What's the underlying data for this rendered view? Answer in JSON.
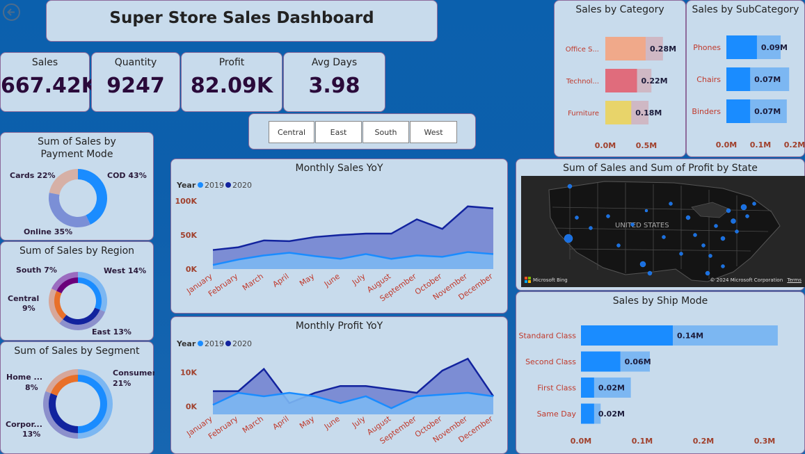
{
  "header": {
    "title": "Super Store Sales Dashboard"
  },
  "kpis": [
    {
      "label": "Sales",
      "value": "667.42K"
    },
    {
      "label": "Quantity",
      "value": "9247"
    },
    {
      "label": "Profit",
      "value": "82.09K"
    },
    {
      "label": "Avg Days",
      "value": "3.98"
    }
  ],
  "slicer": {
    "options": [
      "Central",
      "East",
      "South",
      "West"
    ]
  },
  "colors": {
    "accent": "#1a8cff",
    "dark": "#12239e",
    "light": "#7cb7f2"
  },
  "chart_data": [
    {
      "id": "category",
      "type": "bar",
      "title": "Sales by Category",
      "categories": [
        "Office S...",
        "Technol...",
        "Furniture"
      ],
      "values": [
        0.28,
        0.22,
        0.18
      ],
      "data_labels": [
        "0.28M",
        "0.22M",
        "0.18M"
      ],
      "ticks": [
        "0.0M",
        "0.5M"
      ],
      "colors": [
        "#f0a98a",
        "#e06c7c",
        "#e8d46a"
      ],
      "xlim": [
        0,
        0.57
      ]
    },
    {
      "id": "subcategory",
      "type": "bar",
      "title": "Sales by SubCategory",
      "categories": [
        "Phones",
        "Chairs",
        "Binders"
      ],
      "values": [
        0.09,
        0.07,
        0.07
      ],
      "data_labels": [
        "0.09M",
        "0.07M",
        "0.07M"
      ],
      "ticks": [
        "0.0M",
        "0.1M",
        "0.2M"
      ],
      "xlim": [
        0,
        0.205
      ]
    },
    {
      "id": "payment",
      "type": "pie",
      "title": "Sum of Sales by Payment Mode",
      "labels": [
        "COD 43%",
        "Online 35%",
        "Cards 22%"
      ],
      "values": [
        43,
        35,
        22
      ],
      "colors": [
        "#1a8cff",
        "#7b8fd6",
        "#d6b0a6"
      ]
    },
    {
      "id": "region",
      "type": "pie",
      "title": "Sum of Sales by Region",
      "labels": [
        "West 14%",
        "East 13%",
        "Central 9%",
        "South 7%"
      ],
      "outer": {
        "values": [
          31,
          30,
          21,
          18
        ],
        "colors": [
          "#7cb7f2",
          "#8c90cc",
          "#d7a79a",
          "#9b6cc0"
        ]
      },
      "inner": {
        "values": [
          31,
          30,
          21,
          18
        ],
        "colors": [
          "#1a8cff",
          "#12239e",
          "#e8702a",
          "#6b007b"
        ]
      }
    },
    {
      "id": "segment",
      "type": "pie",
      "title": "Sum of Sales by Segment",
      "labels": [
        "Consumer 21%",
        "Corpor... 13%",
        "Home ... 8%"
      ],
      "outer": {
        "values": [
          50,
          31,
          19
        ],
        "colors": [
          "#7cb7f2",
          "#8c90cc",
          "#d7a79a"
        ]
      },
      "inner": {
        "values": [
          50,
          31,
          19
        ],
        "colors": [
          "#1a8cff",
          "#12239e",
          "#e8702a"
        ]
      }
    },
    {
      "id": "monthly_sales",
      "type": "area",
      "title": "Monthly Sales YoY",
      "legend_title": "Year",
      "x": [
        "January",
        "February",
        "March",
        "April",
        "May",
        "June",
        "July",
        "August",
        "September",
        "October",
        "November",
        "December"
      ],
      "series": [
        {
          "name": "2019",
          "values": [
            6,
            14,
            20,
            24,
            19,
            15,
            22,
            15,
            20,
            18,
            25,
            22
          ]
        },
        {
          "name": "2020",
          "values": [
            28,
            32,
            42,
            41,
            47,
            50,
            52,
            52,
            73,
            59,
            92,
            89
          ]
        }
      ],
      "yticks": [
        "0K",
        "50K",
        "100K"
      ],
      "ylim": [
        0,
        100
      ]
    },
    {
      "id": "monthly_profit",
      "type": "area",
      "title": "Monthly Profit YoY",
      "legend_title": "Year",
      "x": [
        "January",
        "February",
        "March",
        "April",
        "May",
        "June",
        "July",
        "August",
        "September",
        "October",
        "November",
        "December"
      ],
      "series": [
        {
          "name": "2019",
          "values": [
            0.5,
            4,
            3,
            4,
            3,
            1,
            3,
            -0.5,
            3,
            3.5,
            4,
            3
          ]
        },
        {
          "name": "2020",
          "values": [
            4.5,
            4.5,
            11,
            1,
            4,
            6,
            6,
            5,
            4,
            10.5,
            14,
            3
          ]
        }
      ],
      "yticks": [
        "0K",
        "10K"
      ],
      "ylim": [
        -2.3,
        15
      ]
    },
    {
      "id": "shipmode",
      "type": "bar",
      "title": "Sales by Ship Mode",
      "categories": [
        "Standard Class",
        "Second Class",
        "First Class",
        "Same Day"
      ],
      "values": [
        0.14,
        0.06,
        0.02,
        0.02
      ],
      "data_labels": [
        "0.14M",
        "0.06M",
        "0.02M",
        "0.02M"
      ],
      "ticks": [
        "0.0M",
        "0.1M",
        "0.2M",
        "0.3M"
      ],
      "xlim": [
        0,
        0.35
      ]
    }
  ],
  "map": {
    "title": "Sum of Sales and Sum of Profit by State",
    "country_label": "UNITED STATES",
    "attribution": "Microsoft Bing",
    "copyright": "© 2024 Microsoft Corporation",
    "terms": "Terms"
  }
}
